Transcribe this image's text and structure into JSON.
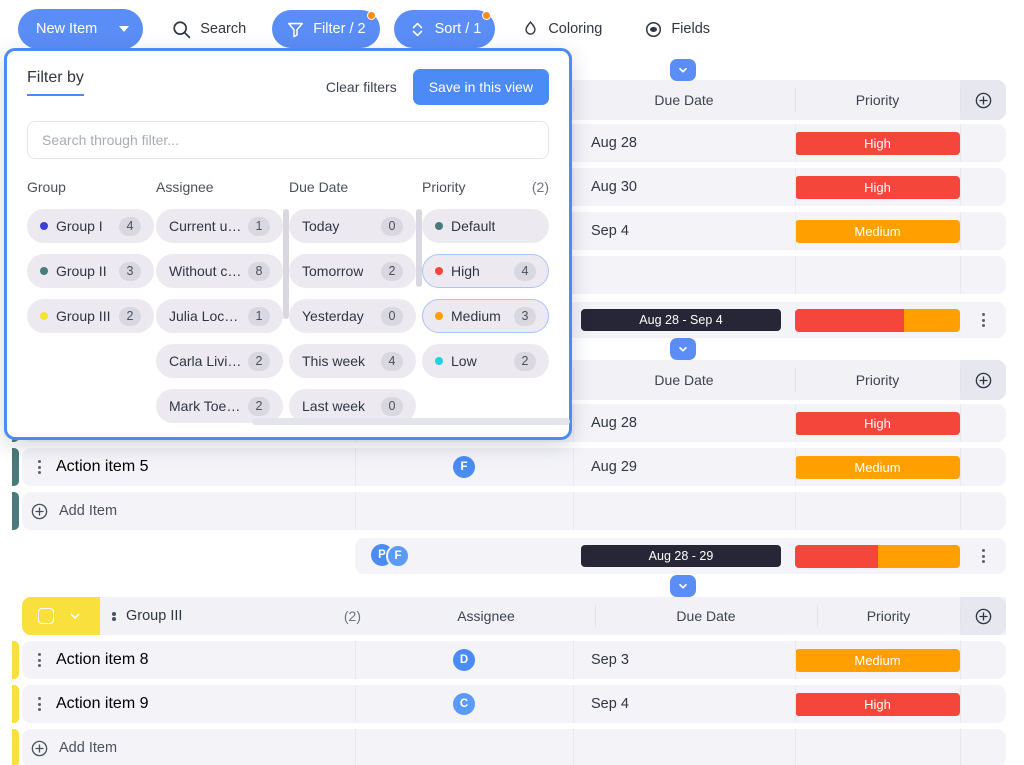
{
  "toolbar": {
    "new_item": {
      "label": "New Item",
      "icon": "caret-down-icon"
    },
    "search": {
      "label": "Search",
      "icon": "search-icon"
    },
    "filter": {
      "label": "Filter / 2",
      "icon": "funnel-icon",
      "badge": true
    },
    "sort": {
      "label": "Sort / 1",
      "icon": "sort-arrows-icon",
      "badge": true
    },
    "coloring": {
      "label": "Coloring",
      "icon": "droplet-icon"
    },
    "fields": {
      "label": "Fields",
      "icon": "eye-icon"
    }
  },
  "filter_panel": {
    "title": "Filter by",
    "clear_label": "Clear filters",
    "save_label": "Save in this view",
    "search_placeholder": "Search through filter...",
    "columns": [
      {
        "name": "Group",
        "count": "",
        "options": [
          {
            "label": "Group I",
            "count": "4",
            "color": "#3b3fd8",
            "selected": false
          },
          {
            "label": "Group II",
            "count": "3",
            "color": "#4a7a7a",
            "selected": false
          },
          {
            "label": "Group III",
            "count": "2",
            "color": "#f5e236",
            "selected": false
          }
        ]
      },
      {
        "name": "Assignee",
        "count": "",
        "options": [
          {
            "label": "Current u…",
            "count": "1",
            "color": "",
            "selected": false
          },
          {
            "label": "Without c…",
            "count": "8",
            "color": "",
            "selected": false
          },
          {
            "label": "Julia Loc…",
            "count": "1",
            "color": "",
            "selected": false
          },
          {
            "label": "Carla Livi…",
            "count": "2",
            "color": "",
            "selected": false
          },
          {
            "label": "Mark Toe…",
            "count": "2",
            "color": "",
            "selected": false
          }
        ]
      },
      {
        "name": "Due Date",
        "count": "",
        "options": [
          {
            "label": "Today",
            "count": "0",
            "color": "",
            "selected": false
          },
          {
            "label": "Tomorrow",
            "count": "2",
            "color": "",
            "selected": false
          },
          {
            "label": "Yesterday",
            "count": "0",
            "color": "",
            "selected": false
          },
          {
            "label": "This week",
            "count": "4",
            "color": "",
            "selected": false
          },
          {
            "label": "Last week",
            "count": "0",
            "color": "",
            "selected": false
          }
        ]
      },
      {
        "name": "Priority",
        "count": "(2)",
        "options": [
          {
            "label": "Default",
            "count": "",
            "color": "#4a7a7a",
            "selected": false
          },
          {
            "label": "High",
            "count": "4",
            "color": "#f5463b",
            "selected": true
          },
          {
            "label": "Medium",
            "count": "3",
            "color": "#ffa000",
            "selected": true
          },
          {
            "label": "Low",
            "count": "2",
            "color": "#23cfe0",
            "selected": false
          }
        ]
      }
    ]
  },
  "table": {
    "headers": {
      "assignee": "Assignee",
      "due_date": "Due Date",
      "priority": "Priority",
      "add_column": "add-column-icon"
    },
    "add_item_label": "Add Item",
    "sections": [
      {
        "id": "group-one",
        "accent": "#4a7a7a",
        "header_hidden": true,
        "rows": [
          {
            "name": "",
            "assignee": "",
            "date": "Aug 28",
            "priority": "High",
            "priority_color": "#f5463b"
          },
          {
            "name": "",
            "assignee": "",
            "date": "Aug 30",
            "priority": "High",
            "priority_color": "#f5463b"
          },
          {
            "name": "",
            "assignee": "",
            "date": "Sep 4",
            "priority": "Medium",
            "priority_color": "#ffa000"
          },
          {
            "name": "",
            "assignee": "",
            "date": "",
            "priority": "",
            "priority_color": ""
          }
        ],
        "summary": {
          "date_range": "Aug 28 - Sep 4",
          "segments": [
            {
              "color": "#f5463b",
              "pct": 66
            },
            {
              "color": "#ffa000",
              "pct": 34
            }
          ]
        }
      },
      {
        "id": "group-two",
        "accent": "#4a7a7a",
        "header_hidden": true,
        "rows": [
          {
            "name": "",
            "assignee": "",
            "date": "Aug 28",
            "priority": "High",
            "priority_color": "#f5463b"
          },
          {
            "name": "Action item 5",
            "assignee": "F",
            "date": "Aug 29",
            "priority": "Medium",
            "priority_color": "#ffa000"
          }
        ],
        "summary": {
          "date_range": "Aug 28 - 29",
          "avatars": [
            "P",
            "F"
          ],
          "segments": [
            {
              "color": "#f5463b",
              "pct": 50
            },
            {
              "color": "#ffa000",
              "pct": 50
            }
          ]
        }
      },
      {
        "id": "group-three",
        "accent": "#f5e236",
        "header_hidden": false,
        "title": "Group III",
        "count": "(2)",
        "rows": [
          {
            "name": "Action item 8",
            "assignee": "D",
            "date": "Sep 3",
            "priority": "Medium",
            "priority_color": "#ffa000"
          },
          {
            "name": "Action item 9",
            "assignee": "C",
            "date": "Sep 4",
            "priority": "High",
            "priority_color": "#f5463b"
          }
        ]
      }
    ]
  }
}
